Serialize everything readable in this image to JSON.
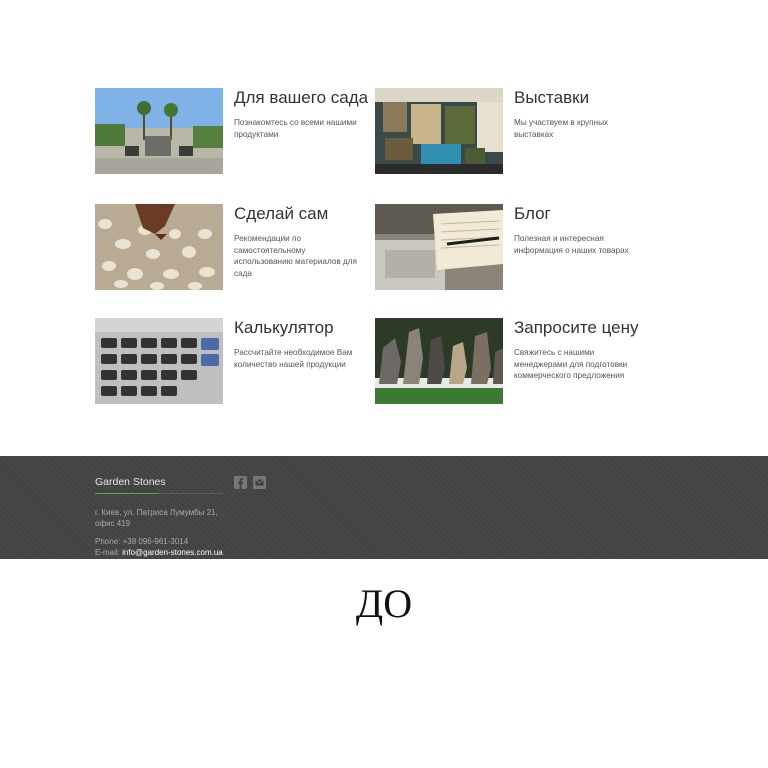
{
  "cards": [
    {
      "title": "Для вашего сада",
      "desc": "Познакомтесь со всеми нашими продуктами"
    },
    {
      "title": "Выставки",
      "desc": "Мы участвуем в крупных выставках"
    },
    {
      "title": "Сделай сам",
      "desc": "Рекомендации по самостоятельному использованию материалов для сада"
    },
    {
      "title": "Блог",
      "desc": "Полезная и интересная информация о наших товарах"
    },
    {
      "title": "Калькулятор",
      "desc": "Рассчитайте необходимое Вам количество нашей продукции"
    },
    {
      "title": "Запросите цену",
      "desc": "Свяжитесь с нашими менеджерами для подготовки коммерческого предложения"
    }
  ],
  "footer": {
    "brand": "Garden Stones",
    "address_line1": "г. Киев, ул. Патриса Лумумбы 21,",
    "address_line2": "офис 419",
    "phone": "Phone: +38 096-961-3014",
    "email_label": "E-mail: ",
    "email": "info@garden-stones.com.ua",
    "social": [
      "facebook-icon",
      "mail-icon"
    ]
  },
  "bottom_text": "ДО",
  "colors": {
    "footer_bg": "#444444",
    "accent": "#4caf50"
  }
}
